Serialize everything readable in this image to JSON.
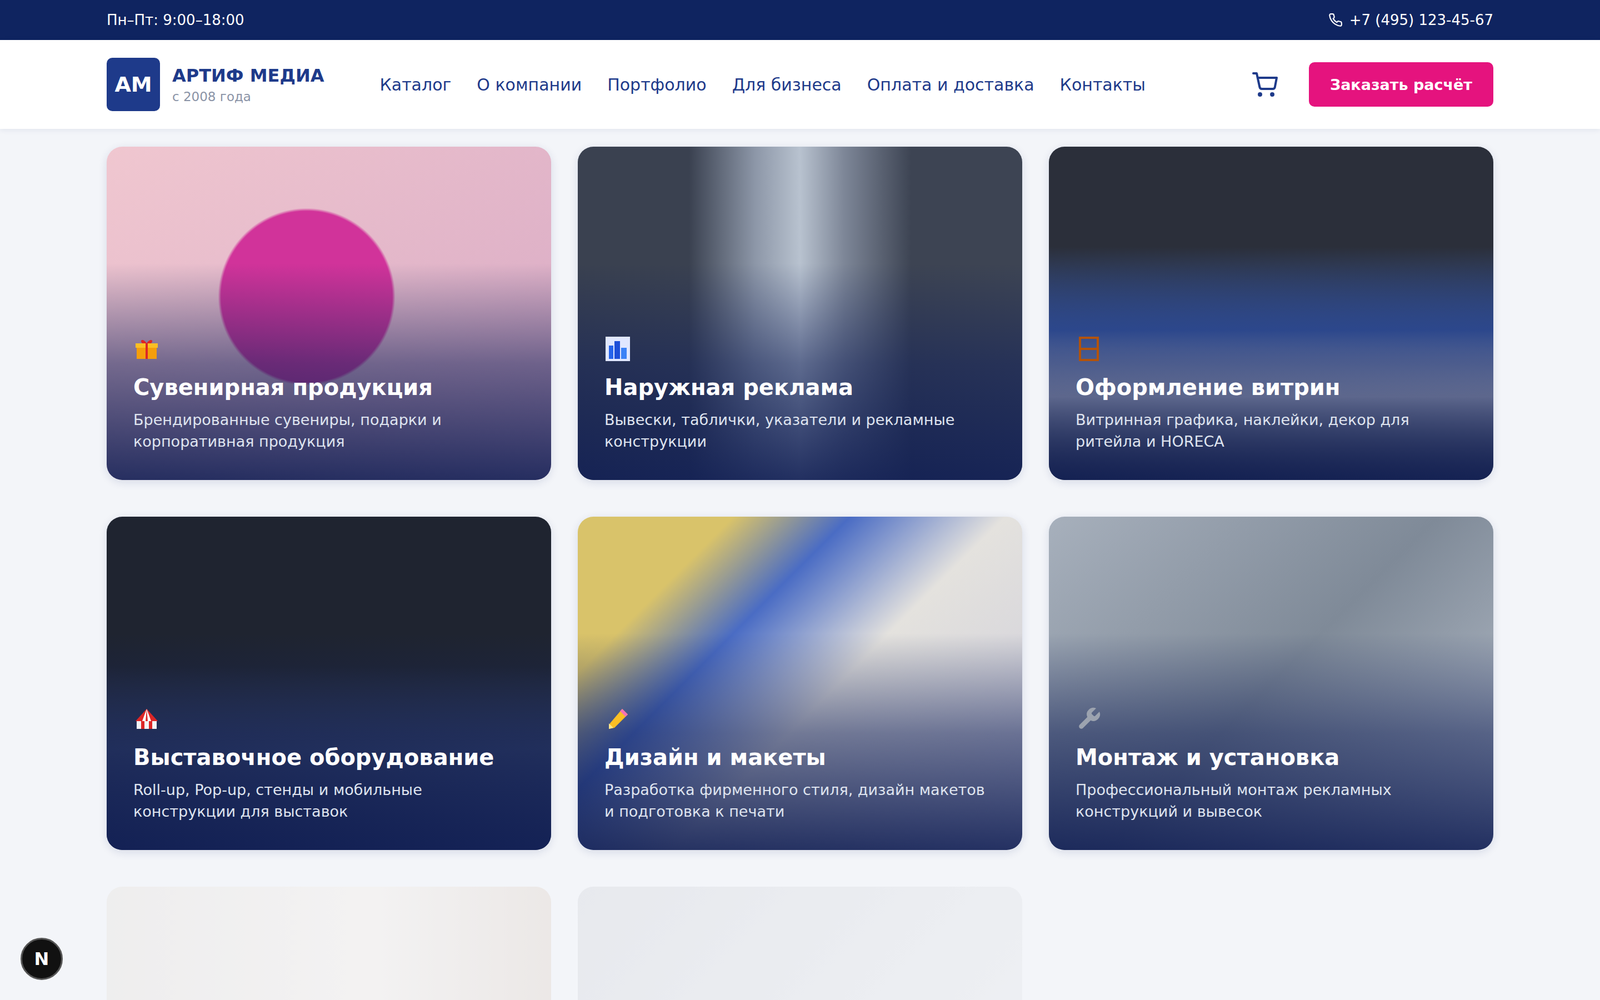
{
  "top_bar": {
    "hours": "Пн–Пт: 9:00–18:00",
    "phone": "+7 (495) 123-45-67"
  },
  "logo": {
    "mark": "АМ",
    "title": "АРТИФ МЕДИА",
    "subtitle": "с 2008 года"
  },
  "nav": [
    {
      "label": "Каталог"
    },
    {
      "label": "О компании"
    },
    {
      "label": "Портфолио"
    },
    {
      "label": "Для бизнеса"
    },
    {
      "label": "Оплата и доставка"
    },
    {
      "label": "Контакты"
    }
  ],
  "cta": "Заказать расчёт",
  "cards": [
    {
      "title": "Сувенирная продукция",
      "description": "Брендированные сувениры, подарки и корпоративная продукция",
      "kind": "gift"
    },
    {
      "title": "Наружная реклама",
      "description": "Вывески, таблички, указатели и рекламные конструкции",
      "kind": "city"
    },
    {
      "title": "Оформление витрин",
      "description": "Витринная графика, наклейки, декор для ритейла и HORECA",
      "kind": "frame"
    },
    {
      "title": "Выставочное оборудование",
      "description": "Roll-up, Pop-up, стенды и мобильные конструкции для выставок",
      "kind": "tent"
    },
    {
      "title": "Дизайн и макеты",
      "description": "Разработка фирменного стиля, дизайн макетов и подготовка к печати",
      "kind": "pencil"
    },
    {
      "title": "Монтаж и установка",
      "description": "Профессиональный монтаж рекламных конструкций и вывесок",
      "kind": "wrench"
    }
  ],
  "loading_cards": [
    {
      "faded": true
    },
    {
      "faded": true
    }
  ],
  "dev_badge": "N"
}
